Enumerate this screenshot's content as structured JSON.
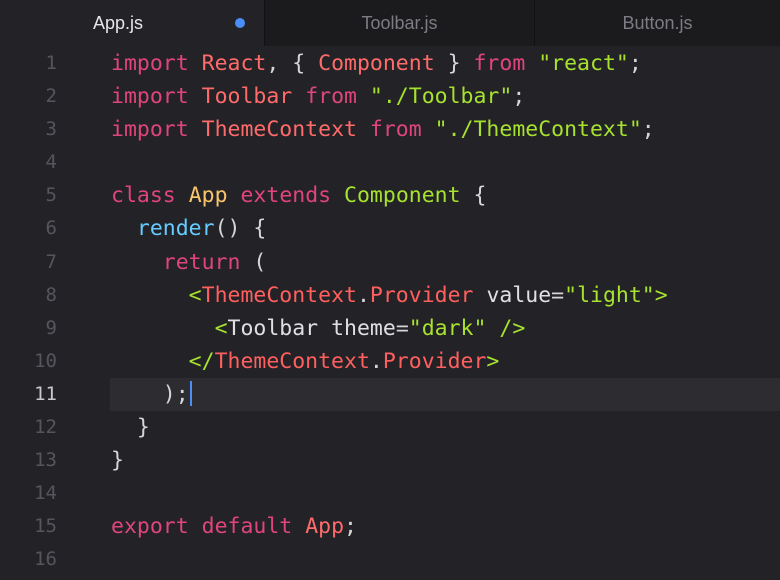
{
  "colors": {
    "keyword": "#e0457a",
    "identifier": "#ff6b6b",
    "class_name": "#f9c56a",
    "string": "#a6e22e",
    "function": "#66ccff",
    "jsx_tag": "#ff5f5f",
    "jsx_attr": "#e0e0e4",
    "punct": "#d6d6da",
    "modified_dot": "#4b8ef7",
    "caret": "#4b8ef7"
  },
  "tabs": [
    {
      "label": "App.js",
      "active": true,
      "modified": true
    },
    {
      "label": "Toolbar.js",
      "active": false,
      "modified": false
    },
    {
      "label": "Button.js",
      "active": false,
      "modified": false
    }
  ],
  "editor": {
    "current_line": 11,
    "lines": [
      {
        "number": "1",
        "tokens": [
          {
            "t": "import",
            "c": "keyword"
          },
          {
            "t": " ",
            "c": "punct"
          },
          {
            "t": "React",
            "c": "identifier"
          },
          {
            "t": ", { ",
            "c": "punct"
          },
          {
            "t": "Component",
            "c": "identifier"
          },
          {
            "t": " } ",
            "c": "punct"
          },
          {
            "t": "from",
            "c": "keyword"
          },
          {
            "t": " ",
            "c": "punct"
          },
          {
            "t": "\"react\"",
            "c": "string"
          },
          {
            "t": ";",
            "c": "punct"
          }
        ]
      },
      {
        "number": "2",
        "tokens": [
          {
            "t": "import",
            "c": "keyword"
          },
          {
            "t": " ",
            "c": "punct"
          },
          {
            "t": "Toolbar",
            "c": "identifier"
          },
          {
            "t": " ",
            "c": "punct"
          },
          {
            "t": "from",
            "c": "keyword"
          },
          {
            "t": " ",
            "c": "punct"
          },
          {
            "t": "\"./Toolbar\"",
            "c": "string"
          },
          {
            "t": ";",
            "c": "punct"
          }
        ]
      },
      {
        "number": "3",
        "tokens": [
          {
            "t": "import",
            "c": "keyword"
          },
          {
            "t": " ",
            "c": "punct"
          },
          {
            "t": "ThemeContext",
            "c": "identifier"
          },
          {
            "t": " ",
            "c": "punct"
          },
          {
            "t": "from",
            "c": "keyword"
          },
          {
            "t": " ",
            "c": "punct"
          },
          {
            "t": "\"./ThemeContext\"",
            "c": "string"
          },
          {
            "t": ";",
            "c": "punct"
          }
        ]
      },
      {
        "number": "4",
        "tokens": []
      },
      {
        "number": "5",
        "tokens": [
          {
            "t": "class",
            "c": "keyword"
          },
          {
            "t": " ",
            "c": "punct"
          },
          {
            "t": "App",
            "c": "class_name"
          },
          {
            "t": " ",
            "c": "punct"
          },
          {
            "t": "extends",
            "c": "keyword"
          },
          {
            "t": " ",
            "c": "punct"
          },
          {
            "t": "Component",
            "c": "string"
          },
          {
            "t": " {",
            "c": "punct"
          }
        ]
      },
      {
        "number": "6",
        "tokens": [
          {
            "t": "  ",
            "c": "punct"
          },
          {
            "t": "render",
            "c": "function"
          },
          {
            "t": "() {",
            "c": "punct"
          }
        ]
      },
      {
        "number": "7",
        "tokens": [
          {
            "t": "    ",
            "c": "punct"
          },
          {
            "t": "return",
            "c": "keyword"
          },
          {
            "t": " (",
            "c": "punct"
          }
        ]
      },
      {
        "number": "8",
        "tokens": [
          {
            "t": "      ",
            "c": "punct"
          },
          {
            "t": "<",
            "c": "string"
          },
          {
            "t": "ThemeContext",
            "c": "jsx_tag"
          },
          {
            "t": ".",
            "c": "punct"
          },
          {
            "t": "Provider",
            "c": "jsx_tag"
          },
          {
            "t": " ",
            "c": "punct"
          },
          {
            "t": "value",
            "c": "jsx_attr"
          },
          {
            "t": "=",
            "c": "punct"
          },
          {
            "t": "\"light\"",
            "c": "string"
          },
          {
            "t": ">",
            "c": "string"
          }
        ]
      },
      {
        "number": "9",
        "tokens": [
          {
            "t": "        ",
            "c": "punct"
          },
          {
            "t": "<",
            "c": "string"
          },
          {
            "t": "Toolbar",
            "c": "jsx_attr"
          },
          {
            "t": " ",
            "c": "punct"
          },
          {
            "t": "theme",
            "c": "jsx_attr"
          },
          {
            "t": "=",
            "c": "punct"
          },
          {
            "t": "\"dark\"",
            "c": "string"
          },
          {
            "t": " ",
            "c": "punct"
          },
          {
            "t": "/>",
            "c": "string"
          }
        ]
      },
      {
        "number": "10",
        "tokens": [
          {
            "t": "      ",
            "c": "punct"
          },
          {
            "t": "</",
            "c": "string"
          },
          {
            "t": "ThemeContext",
            "c": "jsx_tag"
          },
          {
            "t": ".",
            "c": "punct"
          },
          {
            "t": "Provider",
            "c": "jsx_tag"
          },
          {
            "t": ">",
            "c": "string"
          }
        ]
      },
      {
        "number": "11",
        "tokens": [
          {
            "t": "    );",
            "c": "punct"
          }
        ]
      },
      {
        "number": "12",
        "tokens": [
          {
            "t": "  }",
            "c": "punct"
          }
        ]
      },
      {
        "number": "13",
        "tokens": [
          {
            "t": "}",
            "c": "punct"
          }
        ]
      },
      {
        "number": "14",
        "tokens": []
      },
      {
        "number": "15",
        "tokens": [
          {
            "t": "export",
            "c": "keyword"
          },
          {
            "t": " ",
            "c": "punct"
          },
          {
            "t": "default",
            "c": "keyword"
          },
          {
            "t": " ",
            "c": "punct"
          },
          {
            "t": "App",
            "c": "identifier"
          },
          {
            "t": ";",
            "c": "punct"
          }
        ]
      },
      {
        "number": "16",
        "tokens": []
      }
    ]
  }
}
